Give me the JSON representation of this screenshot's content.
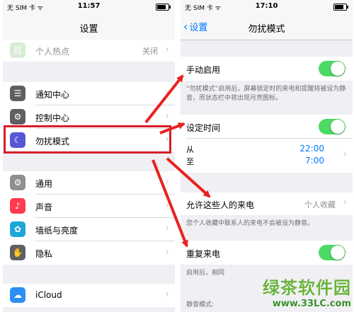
{
  "left": {
    "status": {
      "carrier": "无 SIM 卡 ᯤ",
      "time": "11:57",
      "battery_level": 0.8
    },
    "nav_title": "设置",
    "rows": [
      {
        "label": "个人热点",
        "value": "关闭",
        "icon": "hotspot-icon",
        "color": "#b7e0b0"
      },
      {
        "label": "通知中心",
        "icon": "notification-center-icon",
        "color": "#5f5f63"
      },
      {
        "label": "控制中心",
        "icon": "control-center-icon",
        "color": "#5f5f63"
      },
      {
        "label": "勿扰模式",
        "icon": "moon-icon",
        "color": "#5856d6"
      },
      {
        "label": "通用",
        "icon": "gear-icon",
        "color": "#8e8e93"
      },
      {
        "label": "声音",
        "icon": "speaker-icon",
        "color": "#ff3b50"
      },
      {
        "label": "墙纸与亮度",
        "icon": "wallpaper-icon",
        "color": "#1ea6d8"
      },
      {
        "label": "隐私",
        "icon": "hand-icon",
        "color": "#5f5f63"
      },
      {
        "label": "iCloud",
        "icon": "cloud-icon",
        "color": "#2c8ff3"
      }
    ]
  },
  "right": {
    "status": {
      "carrier": "无 SIM 卡 ᯤ",
      "time": "17:10",
      "battery_level": 0.8
    },
    "back_label": "设置",
    "nav_title": "勿扰模式",
    "manual_label": "手动启用",
    "manual_on": true,
    "manual_note": "“勿扰模式”启用后，屏幕锁定时的来电和提醒将被设为静音，而状态栏中将出现月亮图标。",
    "scheduled_label": "设定时间",
    "scheduled_on": true,
    "from_label": "从",
    "to_label": "至",
    "from_time": "22:00",
    "to_time": "7:00",
    "allow_calls_label": "允许这些人的来电",
    "allow_calls_value": "个人收藏",
    "allow_calls_note": "您个人收藏中联系人的来电不会被设为静音。",
    "repeated_label": "重复来电",
    "repeated_on": true,
    "repeated_note": "启用后，相同",
    "silence_label": "静音模式:"
  },
  "watermark": {
    "title": "绿茶软件园",
    "url": "www.33LC.com"
  },
  "colors": {
    "accent": "#007aff",
    "toggle_on": "#4cd964",
    "highlight": "#d81e2a",
    "arrow": "#e8221f"
  }
}
